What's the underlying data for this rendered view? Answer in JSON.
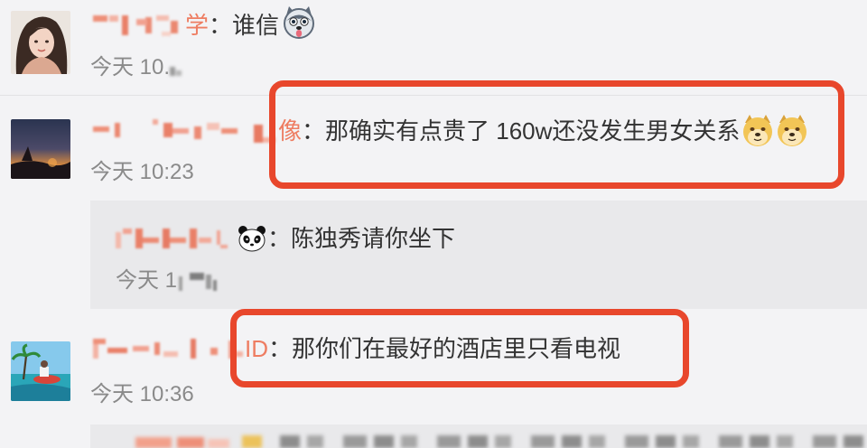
{
  "theme": {
    "background": "#f3f3f5",
    "reply_background": "#e9e9eb",
    "text": "#333333",
    "username": "#ee7d62",
    "time": "#8a8a8a",
    "highlight": "#e8472c"
  },
  "comments": [
    {
      "name_suffix": "学",
      "separator": "：",
      "text": "谁信",
      "emojis": [
        "husky-emoji-icon"
      ],
      "time": "今天 10."
    },
    {
      "name_suffix": "像",
      "separator": "：",
      "text": "那确实有点贵了 160w还没发生男女关系",
      "emojis": [
        "doge-emoji-icon",
        "doge-emoji-icon"
      ],
      "time": "今天 10:23",
      "highlighted": true,
      "replies": [
        {
          "emojis": [
            "panda-emoji-icon"
          ],
          "separator": "：",
          "text": "陈独秀请你坐下",
          "time": "今天 1"
        }
      ]
    },
    {
      "name_suffix": "ID",
      "separator": "：",
      "text": "那你们在最好的酒店里只看电视",
      "time": "今天 10:36",
      "highlighted": true
    }
  ]
}
